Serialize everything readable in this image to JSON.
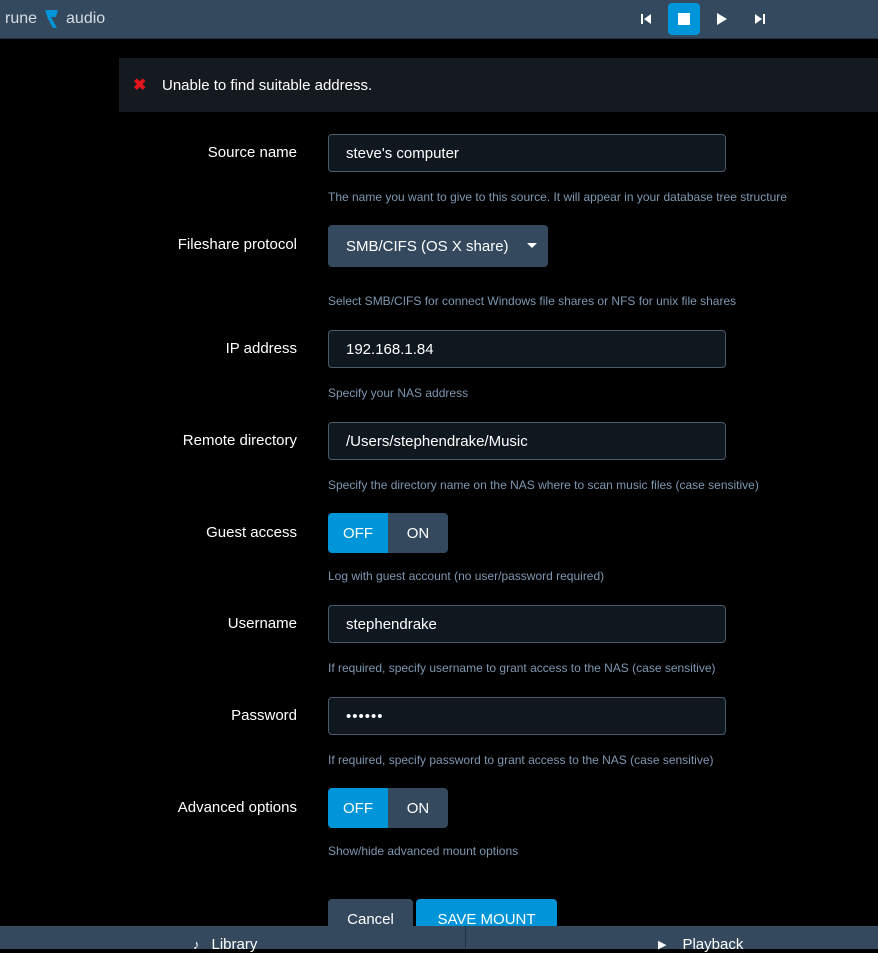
{
  "topbar": {
    "logo_left": "rune",
    "logo_right": "audio",
    "controls": [
      {
        "icon": "previous-icon",
        "active": false
      },
      {
        "icon": "stop-icon",
        "active": true
      },
      {
        "icon": "play-icon",
        "active": false
      },
      {
        "icon": "next-icon",
        "active": false
      }
    ]
  },
  "alert": {
    "icon": "error-x-icon",
    "message": "Unable to find suitable address."
  },
  "form": {
    "source_name": {
      "label": "Source name",
      "value": "steve's computer",
      "help": "The name you want to give to this source. It will appear in your database tree structure"
    },
    "protocol": {
      "label": "Fileshare protocol",
      "value": "SMB/CIFS (OS X share)",
      "help": "Select SMB/CIFS for connect Windows file shares or NFS for unix file shares"
    },
    "ip": {
      "label": "IP address",
      "value": "192.168.1.84",
      "help": "Specify your NAS address"
    },
    "remote_dir": {
      "label": "Remote directory",
      "value": "/Users/stephendrake/Music",
      "help": "Specify the directory name on the NAS where to scan music files (case sensitive)"
    },
    "guest": {
      "label": "Guest access",
      "off": "OFF",
      "on": "ON",
      "selected": "OFF",
      "help": "Log with guest account (no user/password required)"
    },
    "username": {
      "label": "Username",
      "value": "stephendrake",
      "help": "If required, specify username to grant access to the NAS (case sensitive)"
    },
    "password": {
      "label": "Password",
      "value": "••••••",
      "help": "If required, specify password to grant access to the NAS (case sensitive)"
    },
    "advanced": {
      "label": "Advanced options",
      "off": "OFF",
      "on": "ON",
      "selected": "OFF",
      "help": "Show/hide advanced mount options"
    }
  },
  "buttons": {
    "cancel": "Cancel",
    "save": "SAVE MOUNT"
  },
  "bottom_nav": {
    "library": "Library",
    "playback": "Playback"
  },
  "colors": {
    "accent": "#0095d8",
    "bar": "#34495e",
    "help_text": "#7d97b1",
    "error": "#e0161c"
  }
}
